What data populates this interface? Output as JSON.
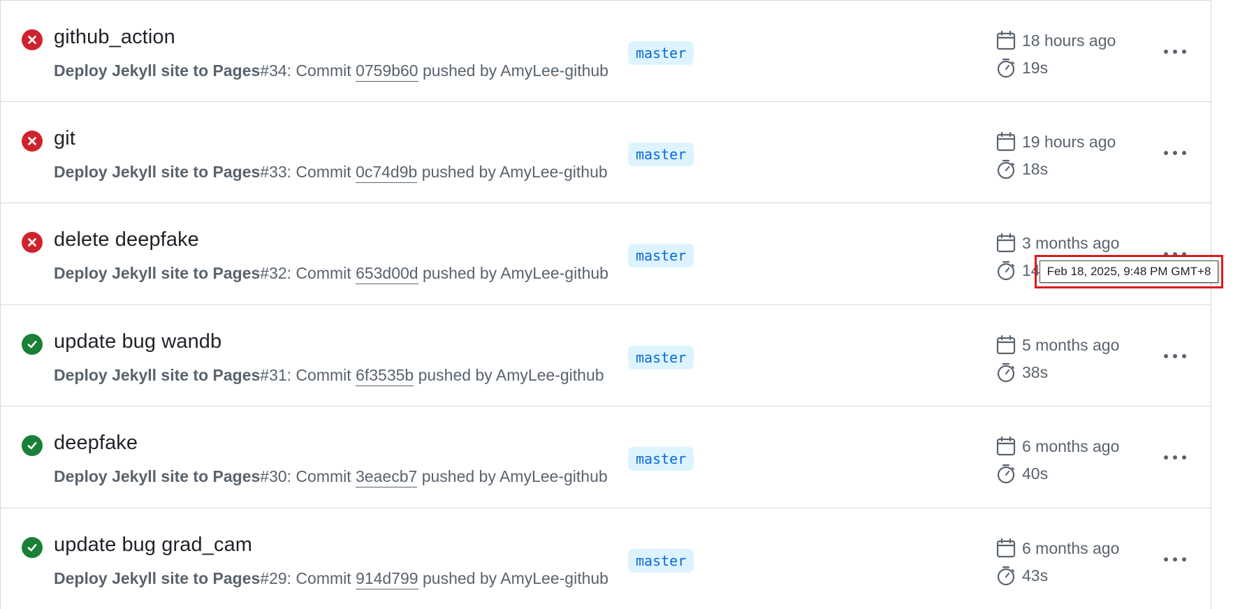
{
  "colors": {
    "failure": "#cf222e",
    "success": "#1a7f37",
    "branch_bg": "#ddf4ff",
    "branch_fg": "#0969da",
    "muted": "#59636e",
    "tooltip_highlight": "#e0191f"
  },
  "icons": {
    "failure": "x-circle-fill-icon",
    "success": "check-circle-fill-icon",
    "date": "calendar-icon",
    "duration": "stopwatch-icon",
    "menu": "kebab-horizontal-icon"
  },
  "runs": [
    {
      "status": "failure",
      "title": "github_action",
      "workflow": "Deploy Jekyll site to Pages",
      "run_number": "#34",
      "commit_prefix": ": Commit ",
      "sha": "0759b60",
      "pushed_by": " pushed by AmyLee-github",
      "branch": "master",
      "time_ago": "18 hours ago",
      "duration": "19s"
    },
    {
      "status": "failure",
      "title": "git",
      "workflow": "Deploy Jekyll site to Pages",
      "run_number": "#33",
      "commit_prefix": ": Commit ",
      "sha": "0c74d9b",
      "pushed_by": " pushed by AmyLee-github",
      "branch": "master",
      "time_ago": "19 hours ago",
      "duration": "18s"
    },
    {
      "status": "failure",
      "title": "delete deepfake",
      "workflow": "Deploy Jekyll site to Pages",
      "run_number": "#32",
      "commit_prefix": ": Commit ",
      "sha": "653d00d",
      "pushed_by": " pushed by AmyLee-github",
      "branch": "master",
      "time_ago": "3 months ago",
      "duration": "14"
    },
    {
      "status": "success",
      "title": "update bug wandb",
      "workflow": "Deploy Jekyll site to Pages",
      "run_number": "#31",
      "commit_prefix": ": Commit ",
      "sha": "6f3535b",
      "pushed_by": " pushed by AmyLee-github",
      "branch": "master",
      "time_ago": "5 months ago",
      "duration": "38s"
    },
    {
      "status": "success",
      "title": "deepfake",
      "workflow": "Deploy Jekyll site to Pages",
      "run_number": "#30",
      "commit_prefix": ": Commit ",
      "sha": "3eaecb7",
      "pushed_by": " pushed by AmyLee-github",
      "branch": "master",
      "time_ago": "6 months ago",
      "duration": "40s"
    },
    {
      "status": "success",
      "title": "update bug grad_cam",
      "workflow": "Deploy Jekyll site to Pages",
      "run_number": "#29",
      "commit_prefix": ": Commit ",
      "sha": "914d799",
      "pushed_by": " pushed by AmyLee-github",
      "branch": "master",
      "time_ago": "6 months ago",
      "duration": "43s"
    }
  ],
  "tooltip": {
    "text": "Feb 18, 2025, 9:48 PM GMT+8"
  }
}
